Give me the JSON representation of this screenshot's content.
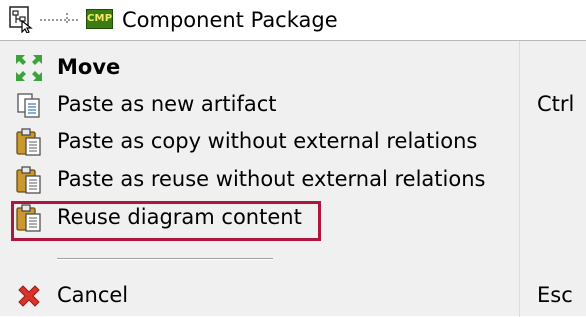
{
  "tree": {
    "package_icon_text": "CMP",
    "package_label": "Component Package"
  },
  "menu": {
    "items": [
      {
        "label": "Move",
        "icon": "move-icon",
        "bold": true
      },
      {
        "label": "Paste as new artifact",
        "icon": "paste-new-icon",
        "shortcut": "Ctrl"
      },
      {
        "label": "Paste as copy without external relations",
        "icon": "clipboard-icon"
      },
      {
        "label": "Paste as reuse without external relations",
        "icon": "clipboard-icon"
      },
      {
        "label": "Reuse diagram content",
        "icon": "clipboard-icon",
        "highlighted": true
      },
      {
        "label": "Cancel",
        "icon": "cancel-icon",
        "shortcut": "Esc"
      }
    ]
  },
  "colors": {
    "menu_background": "#f0f0f0",
    "highlight_border": "#b0153f",
    "move_icon": "#3aa33a",
    "cancel_icon": "#d9342b",
    "package_icon": "#3d7c12"
  }
}
